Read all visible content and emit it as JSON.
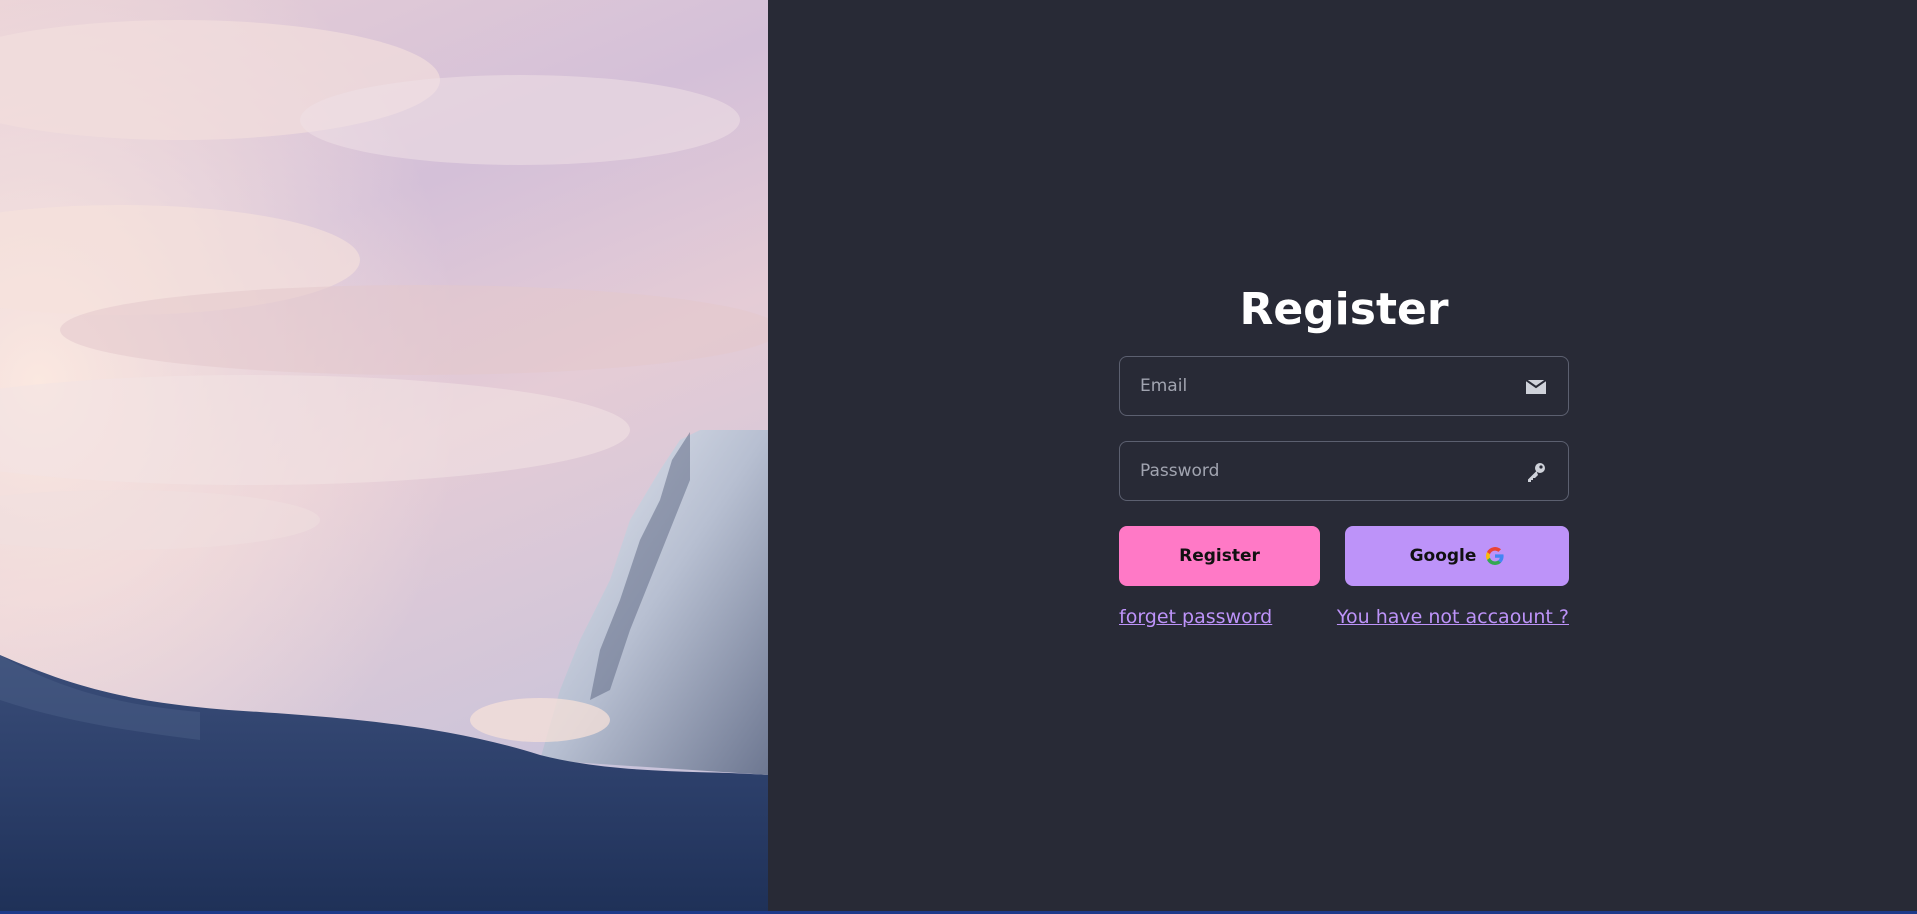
{
  "hero": {
    "image": "mountain-peak-sunset-photo"
  },
  "form": {
    "title": "Register",
    "email": {
      "placeholder": "Email",
      "icon": "mail-icon"
    },
    "password": {
      "placeholder": "Password",
      "icon": "key-icon"
    },
    "register_button": "Register",
    "google_button": "Google",
    "forget_password_link": "forget password",
    "no_account_link": "You have not accaount ?"
  },
  "colors": {
    "background": "#282a36",
    "register_button": "#ff79c6",
    "google_button": "#bd93f9",
    "link": "#bd93f9",
    "title": "#ffffff"
  }
}
